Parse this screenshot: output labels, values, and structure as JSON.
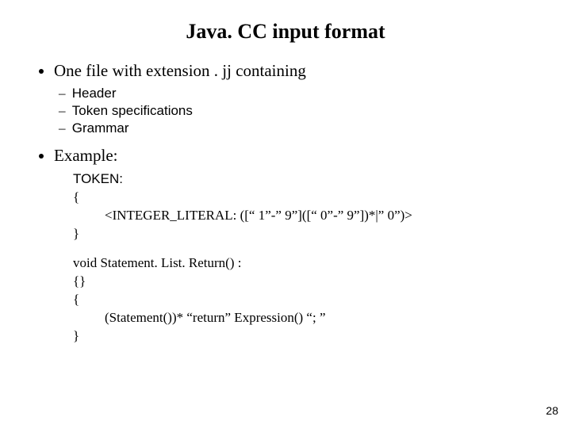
{
  "title": "Java. CC input format",
  "bullets": {
    "intro": "One file with extension . jj containing",
    "sub": [
      "Header",
      "Token specifications",
      "Grammar"
    ],
    "example_label": "Example:"
  },
  "example": {
    "token_kw": "TOKEN:",
    "open": "{",
    "int_lit": "<INTEGER_LITERAL: ([“ 1”-” 9”]([“ 0”-” 9”])*|” 0”)>",
    "close": "}",
    "void_line": "void Statement. List. Return() :",
    "emptybr": "{}",
    "open2": "{",
    "stmt": "(Statement())* “return” Expression() “; ”",
    "close2": "}"
  },
  "page": "28"
}
